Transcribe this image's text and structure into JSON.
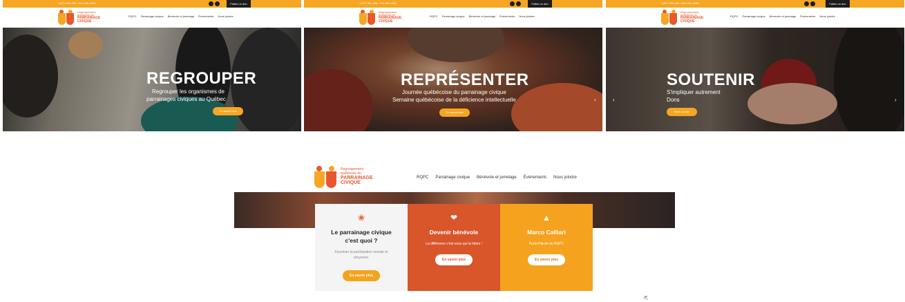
{
  "site": {
    "phone": "1-877-000-000 / 514-000-0000",
    "donate_label": "Faites un don",
    "logo": {
      "line1": "Regroupement",
      "line2": "québécois du",
      "line3": "PARRAINAGE",
      "line4": "CIVIQUE"
    }
  },
  "nav": [
    "RQPC",
    "Parrainage civique",
    "Bénévole et jumelage",
    "Événements",
    "Nous joindre"
  ],
  "slides": [
    {
      "title": "REGROUPER",
      "lines": [
        "Regrouper les organismes de",
        "parrainages civiques au Québec"
      ],
      "cta": "En savoir plus"
    },
    {
      "title": "REPRÉSENTER",
      "lines": [
        "Journée québécoise du parrainage civique",
        "Semaine québécoise de la déficience intellectuelle"
      ],
      "cta": "En savoir plus"
    },
    {
      "title": "SOUTENIR",
      "lines": [
        "S'impliquer autrement",
        "Dons"
      ],
      "cta": "Faire un don"
    }
  ],
  "cards": [
    {
      "icon": "people-icon",
      "title": "Le parrainage civique c'est quoi ?",
      "text": "Favoriser la participation sociale et citoyenne.",
      "cta": "En savoir plus",
      "color": "#f4f4f4"
    },
    {
      "icon": "heart-hand-icon",
      "title": "Devenir bénévole",
      "text": "La différence c'est vous qui la faites !",
      "cta": "En savoir plus",
      "color": "#d9552a"
    },
    {
      "icon": "megaphone-icon",
      "title": "Marco Calliari",
      "text": "Porte-Parole du RQPC",
      "cta": "En savoir plus",
      "color": "#f5a21e"
    }
  ],
  "colors": {
    "brand_orange": "#f5a623",
    "brand_red": "#e8582c",
    "dark": "#1d1d1d"
  }
}
